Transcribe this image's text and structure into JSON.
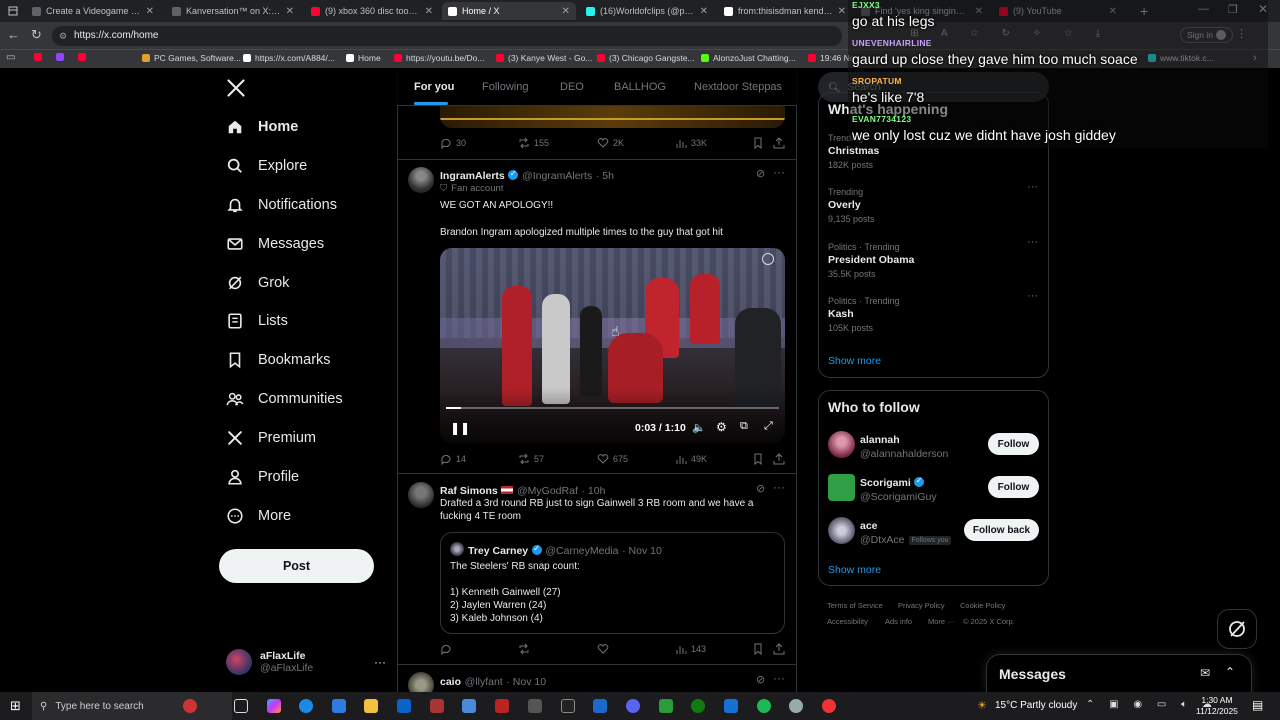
{
  "browser": {
    "tabs": [
      {
        "title": "Create a Videogame franch",
        "color": "#5f6368"
      },
      {
        "title": "Kanversation™ on X: \"Broo",
        "color": "#5f6368"
      },
      {
        "title": "(9) xbox 360 disc toothpast",
        "color": "#ff0033"
      },
      {
        "title": "Home / X",
        "color": "#ffffff"
      },
      {
        "title": "(16)Worldofclips (@parti_ki",
        "color": "#25f4ee"
      },
      {
        "title": "from:thisisdman kendrick -",
        "color": "#ffffff"
      },
      {
        "title": "Find 'yes king singing' on T",
        "color": "#5f6368"
      },
      {
        "title": "(9) YouTube",
        "color": "#ff0033"
      }
    ],
    "url": "https://x.com/home",
    "signin": "Sign in",
    "bookmarks": [
      {
        "label": "",
        "color": "#ff0033"
      },
      {
        "label": "",
        "color": "#9146ff"
      },
      {
        "label": "",
        "color": "#ff0033"
      },
      {
        "label": "PC Games, Software...",
        "color": "#e0a030"
      },
      {
        "label": "https://x.com/A884/...",
        "color": "#ffffff"
      },
      {
        "label": "Home",
        "color": "#ffffff"
      },
      {
        "label": "https://youtu.be/Do...",
        "color": "#ff0033"
      },
      {
        "label": "(3) Kanye West - Go...",
        "color": "#ff0033"
      },
      {
        "label": "(3) Chicago Gangste...",
        "color": "#ff0033"
      },
      {
        "label": "AlonzoJust Chatting...",
        "color": "#53fc18"
      },
      {
        "label": "19:46 No",
        "color": "#ff0033"
      },
      {
        "label": "www.tiktok.c...",
        "color": "#25f4ee"
      }
    ]
  },
  "nav": {
    "items": [
      {
        "label": "Home",
        "icon": "home-icon"
      },
      {
        "label": "Explore",
        "icon": "search-icon"
      },
      {
        "label": "Notifications",
        "icon": "bell-icon"
      },
      {
        "label": "Messages",
        "icon": "mail-icon"
      },
      {
        "label": "Grok",
        "icon": "grok-icon"
      },
      {
        "label": "Lists",
        "icon": "list-icon"
      },
      {
        "label": "Bookmarks",
        "icon": "bookmark-icon"
      },
      {
        "label": "Communities",
        "icon": "people-icon"
      },
      {
        "label": "Premium",
        "icon": "x-icon"
      },
      {
        "label": "Profile",
        "icon": "person-icon"
      },
      {
        "label": "More",
        "icon": "more-circle-icon"
      }
    ],
    "post_label": "Post",
    "account": {
      "name": "aFlaxLife",
      "handle": "@aFlaxLife"
    }
  },
  "feed": {
    "tabs": [
      "For you",
      "Following",
      "DEO",
      "BALLHOG",
      "Nextdoor Steppas"
    ],
    "top_actions": {
      "replies": "30",
      "reposts": "155",
      "likes": "2K",
      "views": "33K"
    },
    "tweet1": {
      "name": "IngramAlerts",
      "handle": "@IngramAlerts",
      "time": "· 5h",
      "badge": "Fan account",
      "text1": "WE GOT AN APOLOGY!!",
      "text2": "Brandon Ingram apologized multiple times to the guy that got hit",
      "video_time": "0:03 / 1:10",
      "video_progress": 0.045,
      "actions": {
        "replies": "14",
        "reposts": "57",
        "likes": "675",
        "views": "49K"
      }
    },
    "tweet2": {
      "name": "Raf Simons",
      "handle": "@MyGodRaf",
      "time": "· 10h",
      "text": "Drafted a 3rd round RB just to sign Gainwell 3 RB room and we have a fucking 4 TE room",
      "quote": {
        "name": "Trey Carney",
        "handle": "@CarneyMedia",
        "time": "· Nov 10",
        "line1": "The Steelers' RB snap count:",
        "line2": "1) Kenneth Gainwell (27)",
        "line3": "2) Jaylen Warren (24)",
        "line4": "3) Kaleb Johnson (4)"
      },
      "actions": {
        "views": "143"
      }
    },
    "tweet3": {
      "name": "caio",
      "handle": "@llyfant",
      "time": "· Nov 10"
    }
  },
  "right": {
    "search_placeholder": "Search",
    "happening_title": "What's happening",
    "trends": [
      {
        "meta": "Trending",
        "name": "Christmas",
        "posts": "182K posts"
      },
      {
        "meta": "Trending",
        "name": "Overly",
        "posts": "9,135 posts"
      },
      {
        "meta": "Politics · Trending",
        "name": "President Obama",
        "posts": "35.5K posts"
      },
      {
        "meta": "Politics · Trending",
        "name": "Kash",
        "posts": "105K posts"
      }
    ],
    "show_more": "Show more",
    "who_title": "Who to follow",
    "follow": [
      {
        "name": "alannah",
        "handle": "@alannahalderson",
        "button": "Follow",
        "follows_you": ""
      },
      {
        "name": "Scorigami",
        "handle": "@ScorigamiGuy",
        "button": "Follow",
        "follows_you": ""
      },
      {
        "name": "ace",
        "handle": "@DtxAce",
        "button": "Follow back",
        "follows_you": "Follows you"
      }
    ],
    "footer": [
      "Terms of Service",
      "Privacy Policy",
      "Cookie Policy",
      "Accessibility",
      "Ads info",
      "More ···",
      "© 2025 X Corp."
    ],
    "messages_label": "Messages"
  },
  "chat": [
    {
      "user": "EJXX3",
      "msg": "go at his legs",
      "color": "#7cff7c"
    },
    {
      "user": "UNEVENHAIRLINE",
      "msg": "gaurd up close they gave him too much soace",
      "color": "#c9a0ff"
    },
    {
      "user": "SROPATUM",
      "msg": "he's like 7'8",
      "color": "#ffb347"
    },
    {
      "user": "EVAN7734123",
      "msg": "we only lost cuz we didnt have josh giddey",
      "color": "#7cff7c"
    }
  ],
  "taskbar": {
    "search_placeholder": "Type here to search",
    "weather": "15°C  Partly cloudy",
    "time": "1:30 AM",
    "date": "11/12/2025"
  }
}
